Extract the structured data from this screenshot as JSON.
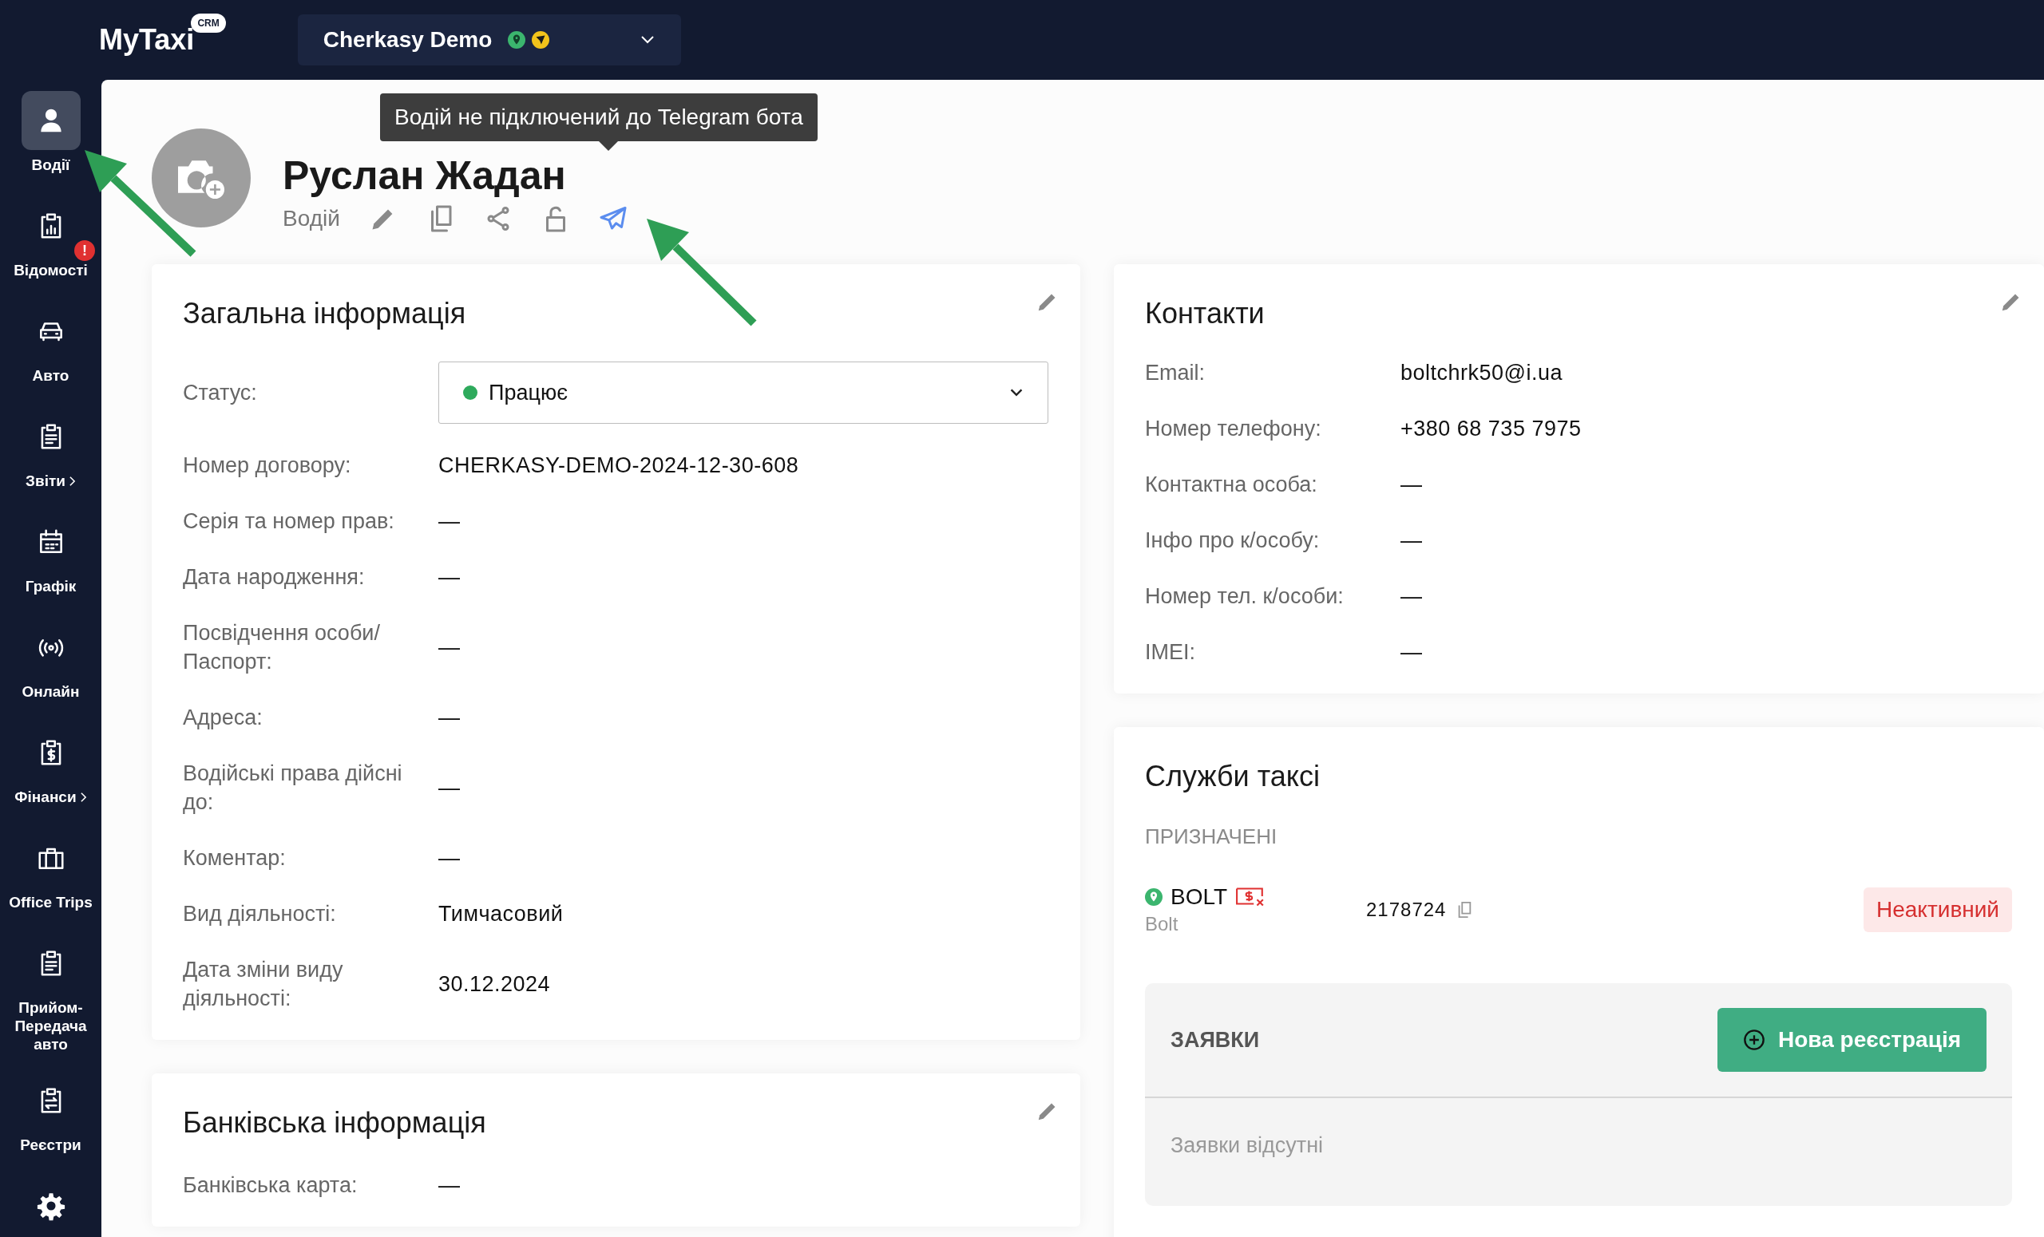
{
  "top_bar": {
    "logo": "MyTaxi",
    "logo_badge": "CRM",
    "company": "Cherkasy Demo"
  },
  "sidebar": {
    "items": [
      {
        "label": "Водії",
        "selected": true,
        "submenu": false
      },
      {
        "label": "Відомості",
        "selected": false,
        "submenu": false,
        "badge": "!"
      },
      {
        "label": "Авто",
        "selected": false,
        "submenu": false
      },
      {
        "label": "Звіти",
        "selected": false,
        "submenu": true
      },
      {
        "label": "Графік",
        "selected": false,
        "submenu": false
      },
      {
        "label": "Онлайн",
        "selected": false,
        "submenu": false
      },
      {
        "label": "Фінанси",
        "selected": false,
        "submenu": true
      },
      {
        "label": "Office Trips",
        "selected": false,
        "submenu": false
      },
      {
        "label": "Прийом-Передача авто",
        "selected": false,
        "submenu": false
      },
      {
        "label": "Реєстри",
        "selected": false,
        "submenu": false
      },
      {
        "selected": false
      }
    ]
  },
  "profile": {
    "name": "Руслан Жадан",
    "role": "Водій",
    "tooltip": "Водій не підключений до Telegram бота",
    "actions": [
      {
        "highlighted": false
      },
      {
        "highlighted": false
      },
      {
        "highlighted": false
      },
      {
        "highlighted": false
      },
      {
        "highlighted": true
      }
    ]
  },
  "general_info": {
    "title": "Загальна інформація",
    "status": {
      "label": "Статус:",
      "value": "Працює",
      "on": true
    },
    "rows": [
      {
        "label": "Номер договору:",
        "value": "CHERKASY-DEMO-2024-12-30-608"
      },
      {
        "label": "Серія та номер прав:",
        "value": "—"
      },
      {
        "label": "Дата народження:",
        "value": "—"
      },
      {
        "label": "Посвідчення особи/ Паспорт:",
        "value": "—"
      },
      {
        "label": "Адреса:",
        "value": "—"
      },
      {
        "label": "Водійські права дійсні до:",
        "value": "—"
      },
      {
        "label": "Коментар:",
        "value": "—"
      },
      {
        "label": "Вид діяльності:",
        "value": "Тимчасовий"
      },
      {
        "label": "Дата зміни виду діяльності:",
        "value": "30.12.2024"
      }
    ]
  },
  "bank_info": {
    "title": "Банківська інформація",
    "rows": [
      {
        "label": "Банківська карта:",
        "value": "—"
      }
    ]
  },
  "contacts": {
    "title": "Контакти",
    "rows": [
      {
        "label": "Email:",
        "value": "boltchrk50@i.ua"
      },
      {
        "label": "Номер телефону:",
        "value": "+380 68 735 7975"
      },
      {
        "label": "Контактна особа:",
        "value": "—"
      },
      {
        "label": "Інфо про к/особу:",
        "value": "—"
      },
      {
        "label": "Номер тел. к/особи:",
        "value": "—"
      },
      {
        "label": "IMEI:",
        "value": "—"
      }
    ]
  },
  "taxi_services": {
    "title": "Служби таксі",
    "assigned_heading": "ПРИЗНАЧЕНІ",
    "services": [
      {
        "name": "BOLT",
        "subtitle": "Bolt",
        "id": "2178724",
        "status": "Неактивний",
        "active": false
      }
    ],
    "requests": {
      "heading": "ЗАЯВКИ",
      "button": "Нова реєстрація",
      "empty": "Заявки відсутні"
    }
  }
}
